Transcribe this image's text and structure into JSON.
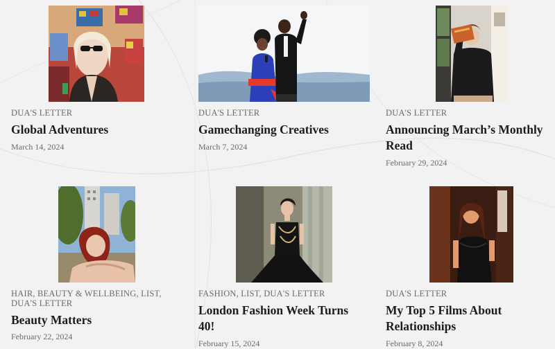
{
  "posts": [
    {
      "category": "DUA'S LETTER",
      "title": "Global Adventures",
      "date": "March 14, 2024",
      "image_alt": "Woman in sunglasses under stained-glass windows"
    },
    {
      "category": "DUA'S LETTER",
      "title": "Gamechanging Creatives",
      "date": "March 7, 2024",
      "image_alt": "Two people on stage with microphone and raised fist"
    },
    {
      "category": "DUA'S LETTER",
      "title": "Announcing March’s Monthly Read",
      "date": "February 29, 2024",
      "image_alt": "Man holding a book above his shoulder"
    },
    {
      "category": "HAIR, BEAUTY & WELLBEING, LIST, DUA'S LETTER",
      "title": "Beauty Matters",
      "date": "February 22, 2024",
      "image_alt": "Woman with red hair resting on a ledge"
    },
    {
      "category": "FASHION, LIST, DUA'S LETTER",
      "title": "London Fashion Week Turns 40!",
      "date": "February 15, 2024",
      "image_alt": "Woman in black strapless gown"
    },
    {
      "category": "DUA'S LETTER",
      "title": "My Top 5 Films About Relationships",
      "date": "February 8, 2024",
      "image_alt": "Woman in black dress in warm red light"
    }
  ]
}
